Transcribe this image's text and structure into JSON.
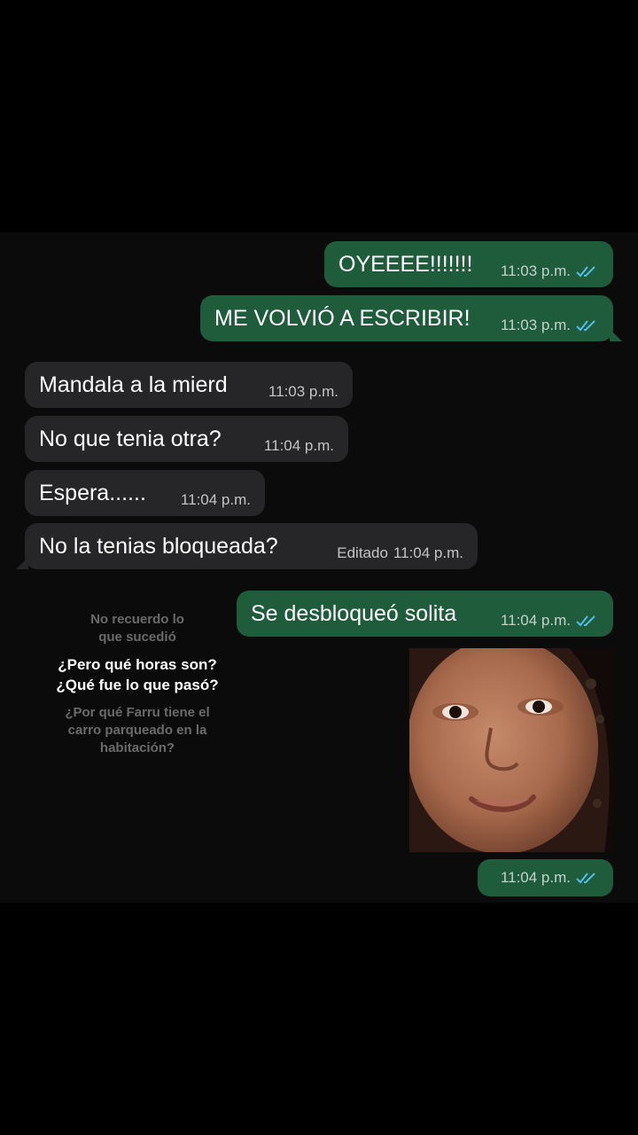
{
  "messages": [
    {
      "text": "OYEEEE!!!!!!!",
      "time": "11:03 p.m."
    },
    {
      "text": "ME VOLVIÓ A ESCRIBIR!",
      "time": "11:03 p.m."
    },
    {
      "text": "Mandala a la mierd",
      "time": "11:03 p.m."
    },
    {
      "text": "No que tenia otra?",
      "time": "11:04 p.m."
    },
    {
      "text": "Espera......",
      "time": "11:04 p.m."
    },
    {
      "text": "No la tenias bloqueada?",
      "edited": "Editado",
      "time": "11:04 p.m."
    },
    {
      "text": "Se desbloqueó solita",
      "time": "11:04 p.m."
    },
    {
      "text": "",
      "time": "11:04 p.m."
    }
  ],
  "meme": {
    "line1": "No recuerdo lo",
    "line2": "que sucedió",
    "line3": "¿Pero qué horas son?",
    "line4": "¿Qué fue lo que pasó?",
    "line5": "¿Por qué Farru tiene el",
    "line6": "carro parqueado en la",
    "line7": "habitación?"
  },
  "colors": {
    "outgoing_bubble": "#1e5c3c",
    "incoming_bubble": "#262628",
    "read_ticks": "#53bdeb"
  },
  "icons": [
    "double-check-icon"
  ]
}
